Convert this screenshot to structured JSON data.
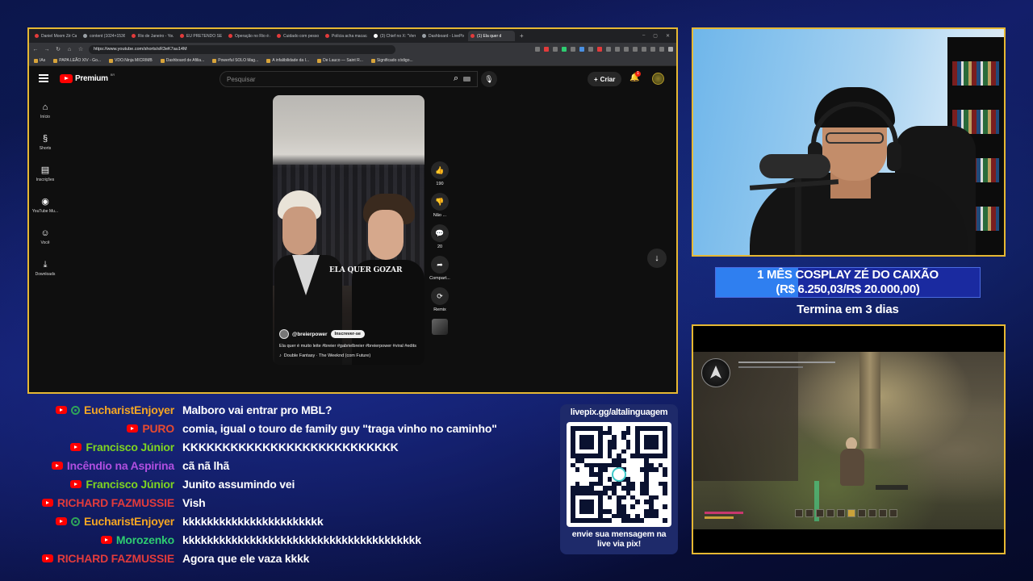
{
  "browser": {
    "tabs": [
      {
        "label": "Daniel Moom Zé Caix",
        "color": "#e23b3b"
      },
      {
        "label": "content (1024×1536)",
        "color": "#9aa0a6"
      },
      {
        "label": "Rio de Janeiro - YouTu",
        "color": "#e23b3b"
      },
      {
        "label": "EU PRETENDO SER CH",
        "color": "#e23b3b"
      },
      {
        "label": "Operação no Rio é ap",
        "color": "#e23b3b"
      },
      {
        "label": "Cuidado com pessoas",
        "color": "#e23b3b"
      },
      {
        "label": "Polícia acha macacão",
        "color": "#e23b3b"
      },
      {
        "label": "(3) Chief no X: \"Verm",
        "color": "#ffffff"
      },
      {
        "label": "Dashboard - LivePix",
        "color": "#9aa0a6"
      },
      {
        "label": "(1) Ela quer d",
        "color": "#e23b3b"
      }
    ],
    "new_tab": "+",
    "window_controls": [
      "–",
      "▢",
      "✕"
    ],
    "url": "https://www.youtube.com/shorts/sR3eK7au14M",
    "bookmarks": [
      "IAs",
      "PAPA LEÃO XIV - Go...",
      "VDO.Ninja MICRIMB",
      "Dashboard de Afilia...",
      "Powerful SOLO Mag...",
      "A infalibilidade da I...",
      "De Lauco — Saint R...",
      "Significado código..."
    ]
  },
  "youtube": {
    "brand": "Premium",
    "region": "BR",
    "search_placeholder": "Pesquisar",
    "create_label": "Criar",
    "notif_count": "1",
    "sidebar": [
      {
        "icon": "⌂",
        "label": "Início"
      },
      {
        "icon": "§",
        "label": "Shorts"
      },
      {
        "icon": "▤",
        "label": "Inscrições"
      },
      {
        "icon": "◉",
        "label": "YouTube Mu..."
      },
      {
        "icon": "☺",
        "label": "Você"
      },
      {
        "icon": "⤓",
        "label": "Downloads"
      }
    ],
    "short": {
      "overlay_title": "ELA QUER GOZAR",
      "channel": "@breierpower",
      "subscribe": "Inscrever-se",
      "description": "Ela quer é muito leite #breier #gabrielbreier #breierpower #viral #edits",
      "song": "Double Fantasy · The Weeknd (com Future)"
    },
    "actions": [
      {
        "icon": "👍",
        "label": "190"
      },
      {
        "icon": "👎",
        "label": "Não ..."
      },
      {
        "icon": "💬",
        "label": "20"
      },
      {
        "icon": "➦",
        "label": "Compart..."
      },
      {
        "icon": "⟳",
        "label": "Remix"
      }
    ]
  },
  "goal": {
    "line1": "1 MÊS COSPLAY ZÉ DO CAIXÃO",
    "line2": "(R$ 6.250,03/R$ 20.000,00)",
    "progress": 0.3125,
    "ends": "Termina em 3 dias"
  },
  "chat": [
    {
      "user": "EucharistEnjoyer",
      "color": "#f5a623",
      "mod": true,
      "text": "Malboro vai entrar pro MBL?"
    },
    {
      "user": "PURO",
      "color": "#e84a2f",
      "mod": false,
      "text": "comia, igual o touro de family guy \"traga vinho no caminho\""
    },
    {
      "user": "Francisco Júnior",
      "color": "#7ed321",
      "mod": false,
      "text": "KKKKKKKKKKKKKKKKKKKKKKKKKKK"
    },
    {
      "user": "Incêndio na Aspirina",
      "color": "#b04fe0",
      "mod": false,
      "text": "cã nã lhã"
    },
    {
      "user": "Francisco Júnior",
      "color": "#7ed321",
      "mod": false,
      "text": "Junito assumindo vei"
    },
    {
      "user": "RICHARD FAZMUSSIE",
      "color": "#e23b3b",
      "mod": false,
      "text": "Vish"
    },
    {
      "user": "EucharistEnjoyer",
      "color": "#f5a623",
      "mod": true,
      "text": "kkkkkkkkkkkkkkkkkkkkkkk"
    },
    {
      "user": "Morozenko",
      "color": "#2ecc71",
      "mod": false,
      "text": "kkkkkkkkkkkkkkkkkkkkkkkkkkkkkkkkkkkkkkk"
    },
    {
      "user": "RICHARD FAZMUSSIE",
      "color": "#e23b3b",
      "mod": false,
      "text": "Agora que ele vaza kkkk"
    }
  ],
  "qr": {
    "url": "livepix.gg/altalinguagem",
    "footer_line1": "envie sua mensagem na",
    "footer_line2": "live via pix!"
  }
}
